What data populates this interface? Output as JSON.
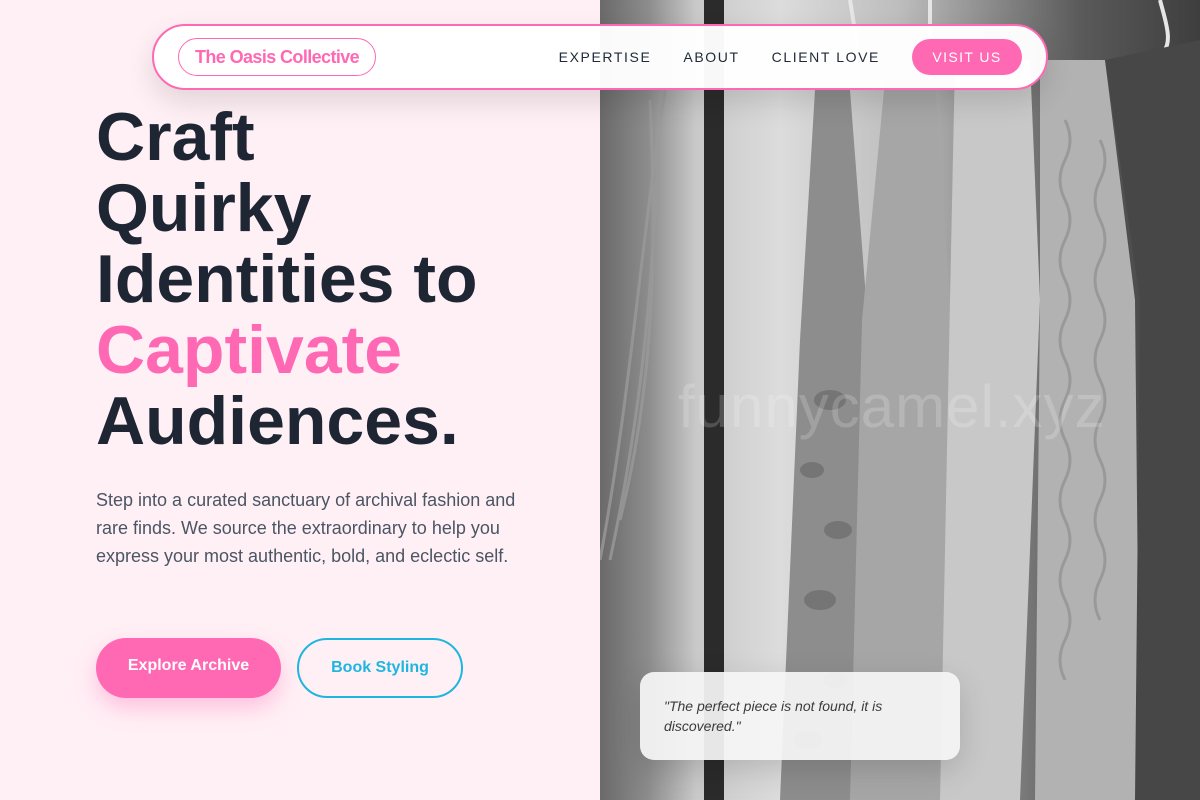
{
  "nav": {
    "logo": "The Oasis Collective",
    "links": [
      "EXPERTISE",
      "ABOUT",
      "CLIENT LOVE"
    ],
    "cta": "VISIT US"
  },
  "hero": {
    "headline_lines": [
      "Craft",
      "Quirky",
      "Identities to"
    ],
    "headline_accent": "Captivate",
    "headline_end": "Audiences.",
    "description": "Step into a curated sanctuary of archival fashion and rare finds. We source the extraordinary to help you express your most authentic, bold, and eclectic self.",
    "primary_cta": "Explore Archive",
    "secondary_cta": "Book Styling"
  },
  "photo": {
    "watermark": "funnycamel.xyz",
    "quote": "\"The perfect piece is not found, it is discovered.\""
  },
  "colors": {
    "background": "#fff0f5",
    "accent_pink": "#ff69b4",
    "accent_cyan": "#1eb6e0",
    "heading": "#1e2533"
  }
}
